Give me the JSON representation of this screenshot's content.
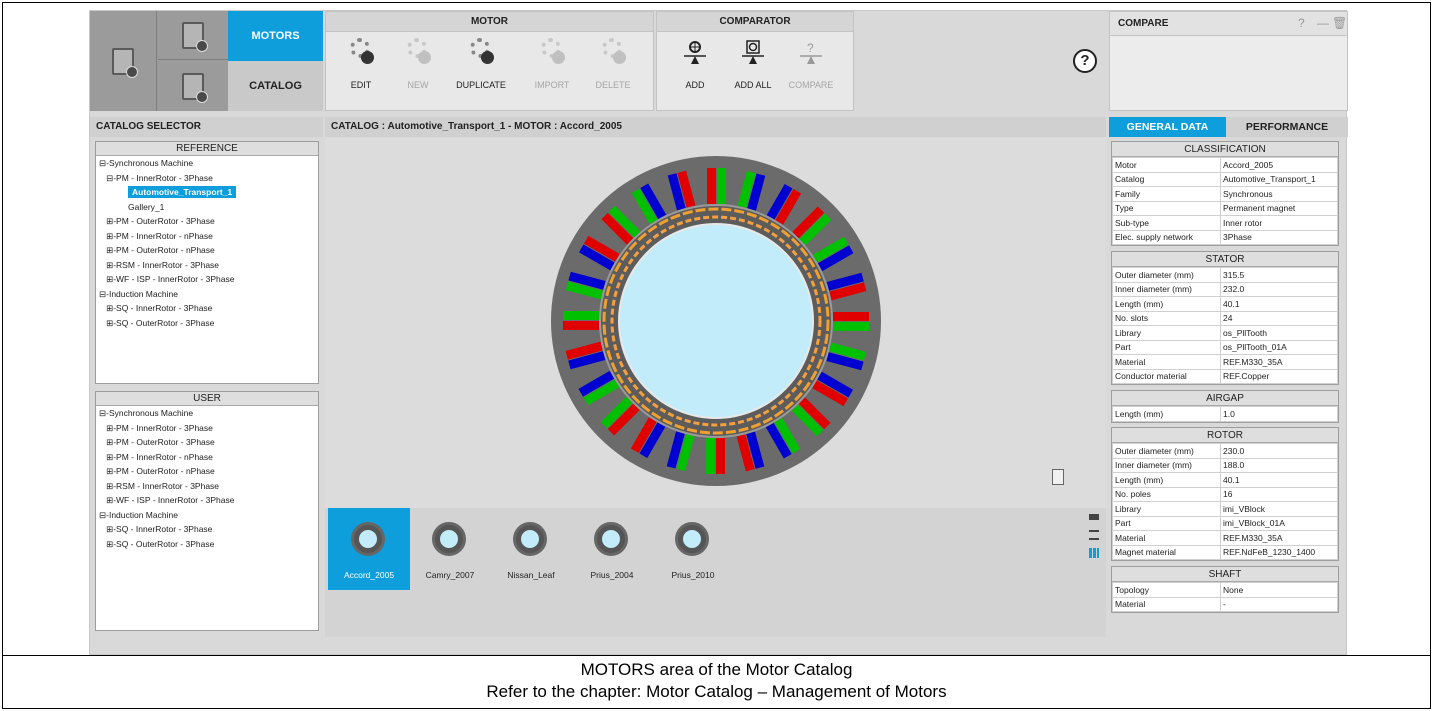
{
  "top_quad": {
    "motors_label": "MOTORS",
    "catalog_label": "CATALOG"
  },
  "motor_group": {
    "title": "MOTOR",
    "tools": [
      {
        "label": "EDIT",
        "enabled": true
      },
      {
        "label": "NEW",
        "enabled": false
      },
      {
        "label": "DUPLICATE",
        "enabled": true
      },
      {
        "label": "IMPORT",
        "enabled": false
      },
      {
        "label": "DELETE",
        "enabled": false
      }
    ]
  },
  "comparator_group": {
    "title": "COMPARATOR",
    "tools": [
      {
        "label": "ADD",
        "enabled": true
      },
      {
        "label": "ADD ALL",
        "enabled": true
      },
      {
        "label": "COMPARE",
        "enabled": false
      }
    ]
  },
  "help_symbol": "?",
  "compare_panel": {
    "title": "COMPARE",
    "controls": [
      "?",
      "—",
      "🗑"
    ]
  },
  "catalog_selector": {
    "title": "CATALOG SELECTOR",
    "reference": {
      "title": "REFERENCE",
      "items": [
        "⊟-Synchronous Machine",
        "   ⊟-PM - InnerRotor - 3Phase",
        "Automotive_Transport_1",
        "Gallery_1",
        "   ⊞-PM - OuterRotor - 3Phase",
        "   ⊞-PM - InnerRotor - nPhase",
        "   ⊞-PM - OuterRotor - nPhase",
        "   ⊞-RSM - InnerRotor - 3Phase",
        "   ⊞-WF - ISP - InnerRotor - 3Phase",
        "⊟-Induction Machine",
        "   ⊞-SQ - InnerRotor - 3Phase",
        "   ⊞-SQ - OuterRotor - 3Phase"
      ]
    },
    "user": {
      "title": "USER",
      "items": [
        "⊟-Synchronous Machine",
        "   ⊞-PM - InnerRotor - 3Phase",
        "   ⊞-PM - OuterRotor - 3Phase",
        "   ⊞-PM - InnerRotor - nPhase",
        "   ⊞-PM - OuterRotor - nPhase",
        "   ⊞-RSM - InnerRotor - 3Phase",
        "   ⊞-WF - ISP - InnerRotor - 3Phase",
        "⊟-Induction Machine",
        "   ⊞-SQ - InnerRotor - 3Phase",
        "   ⊞-SQ - OuterRotor - 3Phase"
      ]
    }
  },
  "center": {
    "title": "CATALOG : Automotive_Transport_1   -  MOTOR : Accord_2005",
    "stator_slots": 24,
    "phase_colors": [
      "#e00000",
      "#00c000",
      "#0000d0"
    ],
    "thumbnails": [
      "Accord_2005",
      "Camry_2007",
      "Nissan_Leaf",
      "Prius_2004",
      "Prius_2010"
    ],
    "selected_thumbnail": "Accord_2005"
  },
  "right_tabs": {
    "general": "GENERAL DATA",
    "performance": "PERFORMANCE"
  },
  "classification": {
    "title": "CLASSIFICATION",
    "rows": [
      [
        "Motor",
        "Accord_2005"
      ],
      [
        "Catalog",
        "Automotive_Transport_1"
      ],
      [
        "Family",
        "Synchronous"
      ],
      [
        "Type",
        "Permanent magnet"
      ],
      [
        "Sub-type",
        "Inner rotor"
      ],
      [
        "Elec. supply network",
        "3Phase"
      ]
    ]
  },
  "stator": {
    "title": "STATOR",
    "rows": [
      [
        "Outer diameter (mm)",
        "315.5"
      ],
      [
        "Inner diameter (mm)",
        "232.0"
      ],
      [
        "Length (mm)",
        "40.1"
      ],
      [
        "No. slots",
        "24"
      ],
      [
        "Library",
        "os_PllTooth"
      ],
      [
        "Part",
        "os_PllTooth_01A"
      ],
      [
        "Material",
        "REF.M330_35A"
      ],
      [
        "Conductor material",
        "REF.Copper"
      ]
    ]
  },
  "airgap": {
    "title": "AIRGAP",
    "rows": [
      [
        "Length (mm)",
        "1.0"
      ]
    ]
  },
  "rotor": {
    "title": "ROTOR",
    "rows": [
      [
        "Outer diameter (mm)",
        "230.0"
      ],
      [
        "Inner diameter (mm)",
        "188.0"
      ],
      [
        "Length (mm)",
        "40.1"
      ],
      [
        "No. poles",
        "16"
      ],
      [
        "Library",
        "imi_VBlock"
      ],
      [
        "Part",
        "imi_VBlock_01A"
      ],
      [
        "Material",
        "REF.M330_35A"
      ],
      [
        "Magnet material",
        "REF.NdFeB_1230_1400"
      ]
    ]
  },
  "shaft": {
    "title": "SHAFT",
    "rows": [
      [
        "Topology",
        "None"
      ],
      [
        "Material",
        "-"
      ]
    ]
  },
  "caption": {
    "line1": "MOTORS area of the Motor Catalog",
    "line2": "Refer to the chapter: Motor Catalog – Management of Motors"
  }
}
